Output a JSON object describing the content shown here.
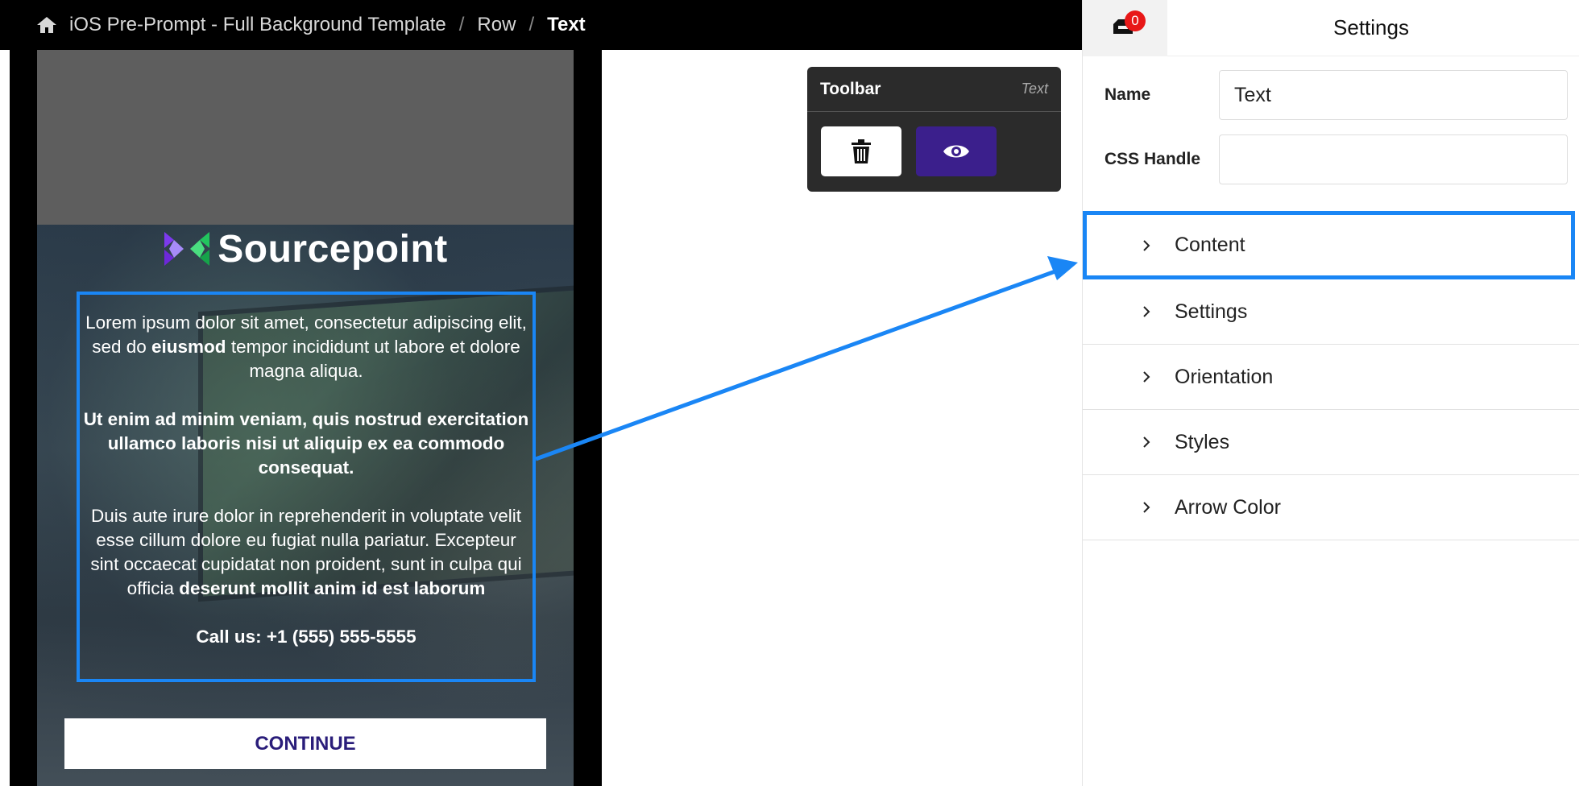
{
  "breadcrumb": {
    "items": [
      "iOS Pre-Prompt - Full Background Template",
      "Row",
      "Text"
    ],
    "separator": "/"
  },
  "preview": {
    "logo_text": "Sourcepoint",
    "paragraph1_a": "Lorem ipsum dolor sit amet, consectetur adipiscing elit, sed do ",
    "paragraph1_bold": "eiusmod",
    "paragraph1_b": " tempor incididunt ut labore et dolore magna aliqua.",
    "paragraph2": "Ut enim ad minim veniam, quis nostrud exercitation ullamco laboris nisi ut aliquip ex ea commodo consequat.",
    "paragraph3_a": "Duis aute irure dolor in reprehenderit in voluptate velit esse cillum dolore eu fugiat nulla pariatur. Excepteur sint occaecat cupidatat non proident, sunt in culpa qui officia ",
    "paragraph3_bold": "deserunt mollit anim id est laborum",
    "phone_line": "Call us: +1 (555) 555-5555",
    "continue_label": "CONTINUE"
  },
  "toolbar": {
    "title": "Toolbar",
    "type_label": "Text",
    "delete_icon": "trash-icon",
    "preview_icon": "eye-icon"
  },
  "settings": {
    "notification_count": "0",
    "title": "Settings",
    "name_label": "Name",
    "name_value": "Text",
    "css_handle_label": "CSS Handle",
    "css_handle_value": "",
    "sections": [
      "Content",
      "Settings",
      "Orientation",
      "Styles",
      "Arrow Color"
    ]
  },
  "colors": {
    "highlight": "#1a86f5",
    "preview_button": "#3b1f8c",
    "continue_text": "#2a1d7a",
    "badge": "#e81717"
  }
}
